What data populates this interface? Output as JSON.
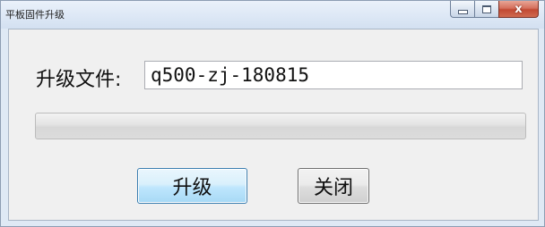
{
  "window": {
    "title": "平板固件升级",
    "caption": {
      "minimize_icon": "minimize-icon",
      "maximize_icon": "maximize-icon",
      "close_icon": "close-icon",
      "close_glyph": "x"
    }
  },
  "form": {
    "file_label": "升级文件:",
    "file_value": "q500-zj-180815"
  },
  "progress": {
    "value_percent": 0
  },
  "buttons": {
    "upgrade_label": "升级",
    "close_label": "关闭"
  },
  "colors": {
    "titlebar": "#dce7f5",
    "client_bg": "#f0f0f0",
    "close_button": "#c24a33",
    "default_button_border": "#3c7fb1"
  }
}
